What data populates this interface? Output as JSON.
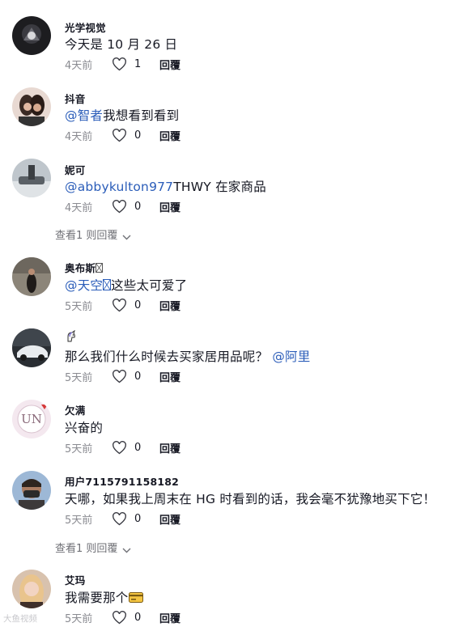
{
  "comments": [
    {
      "username": "光学视觉",
      "text": "今天是 10 月 26 日",
      "time": "4天前",
      "likes": "1",
      "reply": "回覆"
    },
    {
      "username": "抖音",
      "mention": "@智者",
      "text": "我想看到看到",
      "time": "4天前",
      "likes": "0",
      "reply": "回覆"
    },
    {
      "username": "妮可",
      "mention": "@abbykulton977",
      "text": "THWY 在家商品",
      "time": "4天前",
      "likes": "0",
      "reply": "回覆",
      "view_replies": "查看1 则回覆"
    },
    {
      "username": "奥布斯",
      "username_icon": "broken-emoji-icon",
      "mention": "@天空",
      "mention_icon": "broken-emoji-icon",
      "text": "这些太可爱了",
      "time": "5天前",
      "likes": "0",
      "reply": "回覆"
    },
    {
      "username": "",
      "username_icon": "unicorn-icon",
      "text": "那么我们什么时候去买家居用品呢？",
      "mention": "@阿里",
      "time": "5天前",
      "likes": "0",
      "reply": "回覆"
    },
    {
      "username": "欠满",
      "text": "兴奋的",
      "time": "5天前",
      "likes": "0",
      "reply": "回覆"
    },
    {
      "username": "用户7115791158182",
      "text": "天哪，如果我上周末在 HG 时看到的话，我会毫不犹豫地买下它！",
      "time": "5天前",
      "likes": "0",
      "reply": "回覆",
      "view_replies": "查看1 则回覆"
    },
    {
      "username": "艾玛",
      "text": "我需要那个",
      "text_icon": "credit-card-icon",
      "time": "5天前",
      "likes": "0",
      "reply": "回覆"
    }
  ],
  "watermark": "大鱼视频"
}
